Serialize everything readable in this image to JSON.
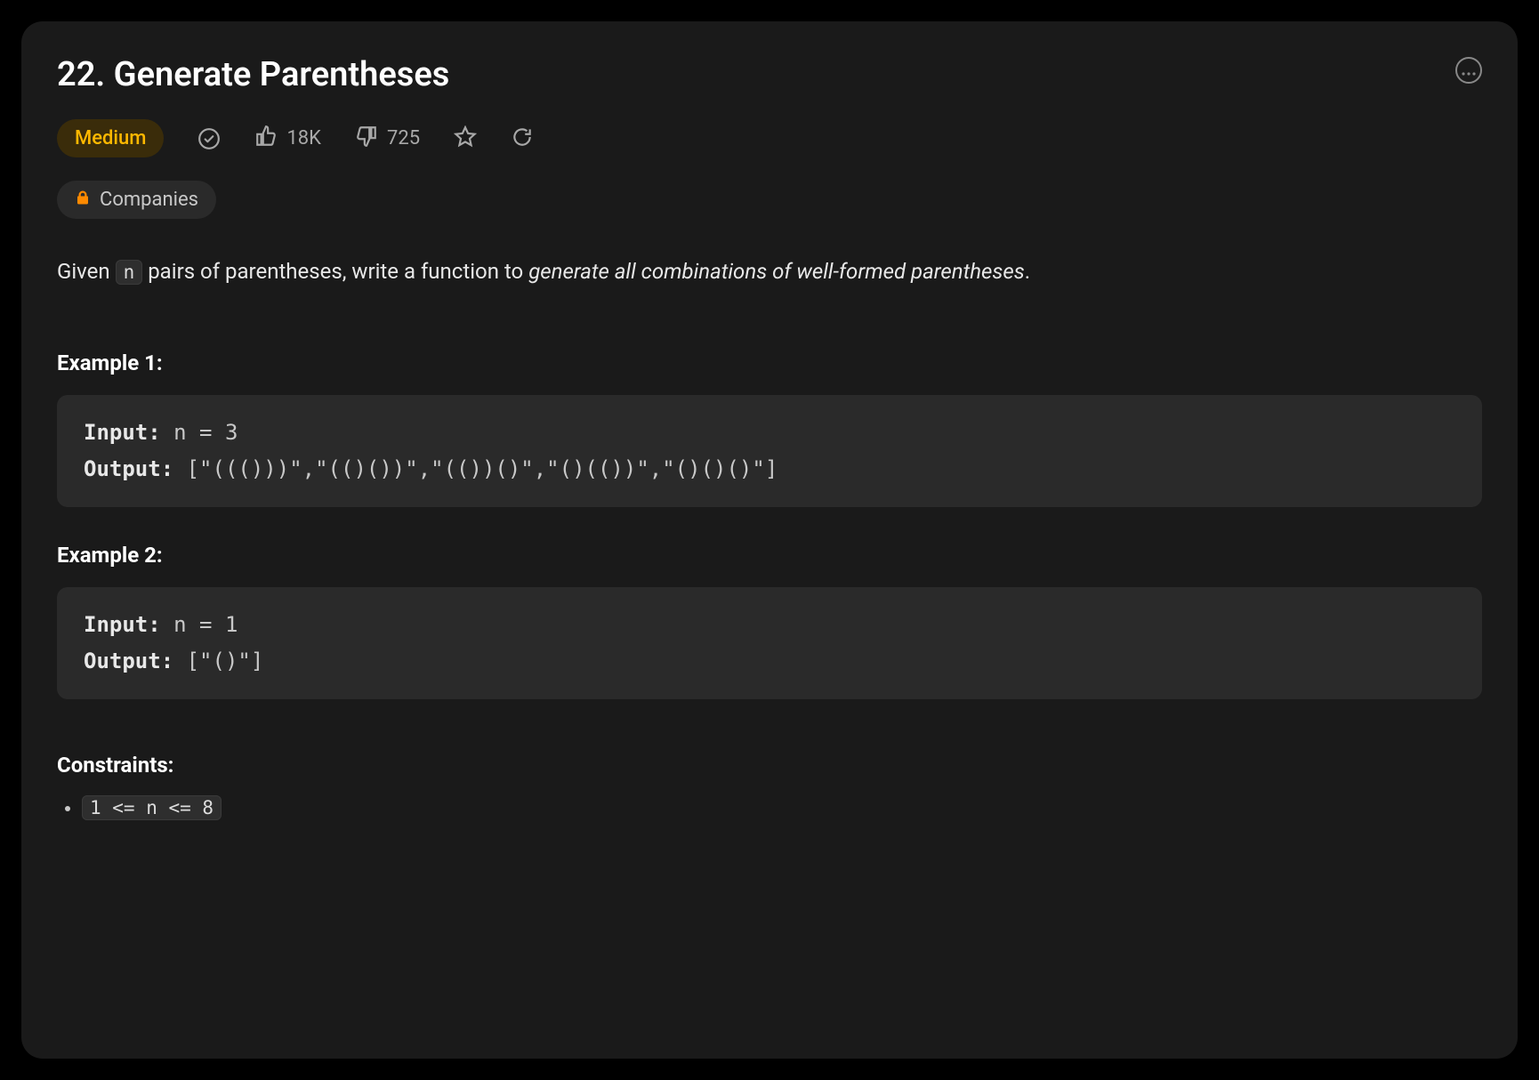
{
  "title": "22. Generate Parentheses",
  "difficulty": "Medium",
  "stats": {
    "likes": "18K",
    "dislikes": "725"
  },
  "tags": {
    "companies": "Companies"
  },
  "description": {
    "prefix": "Given ",
    "varname": "n",
    "mid": " pairs of parentheses, write a function to ",
    "italic": "generate all combinations of well-formed parentheses",
    "suffix": "."
  },
  "examples": [
    {
      "title": "Example 1:",
      "input_label": "Input:",
      "input_value": " n = 3",
      "output_label": "Output:",
      "output_value": " [\"((()))\",\"(()())\",\"(())()\",\"()(())\",\"()()()\"]"
    },
    {
      "title": "Example 2:",
      "input_label": "Input:",
      "input_value": " n = 1",
      "output_label": "Output:",
      "output_value": " [\"()\"]"
    }
  ],
  "constraints": {
    "title": "Constraints:",
    "items": [
      "1 <= n <= 8"
    ]
  }
}
